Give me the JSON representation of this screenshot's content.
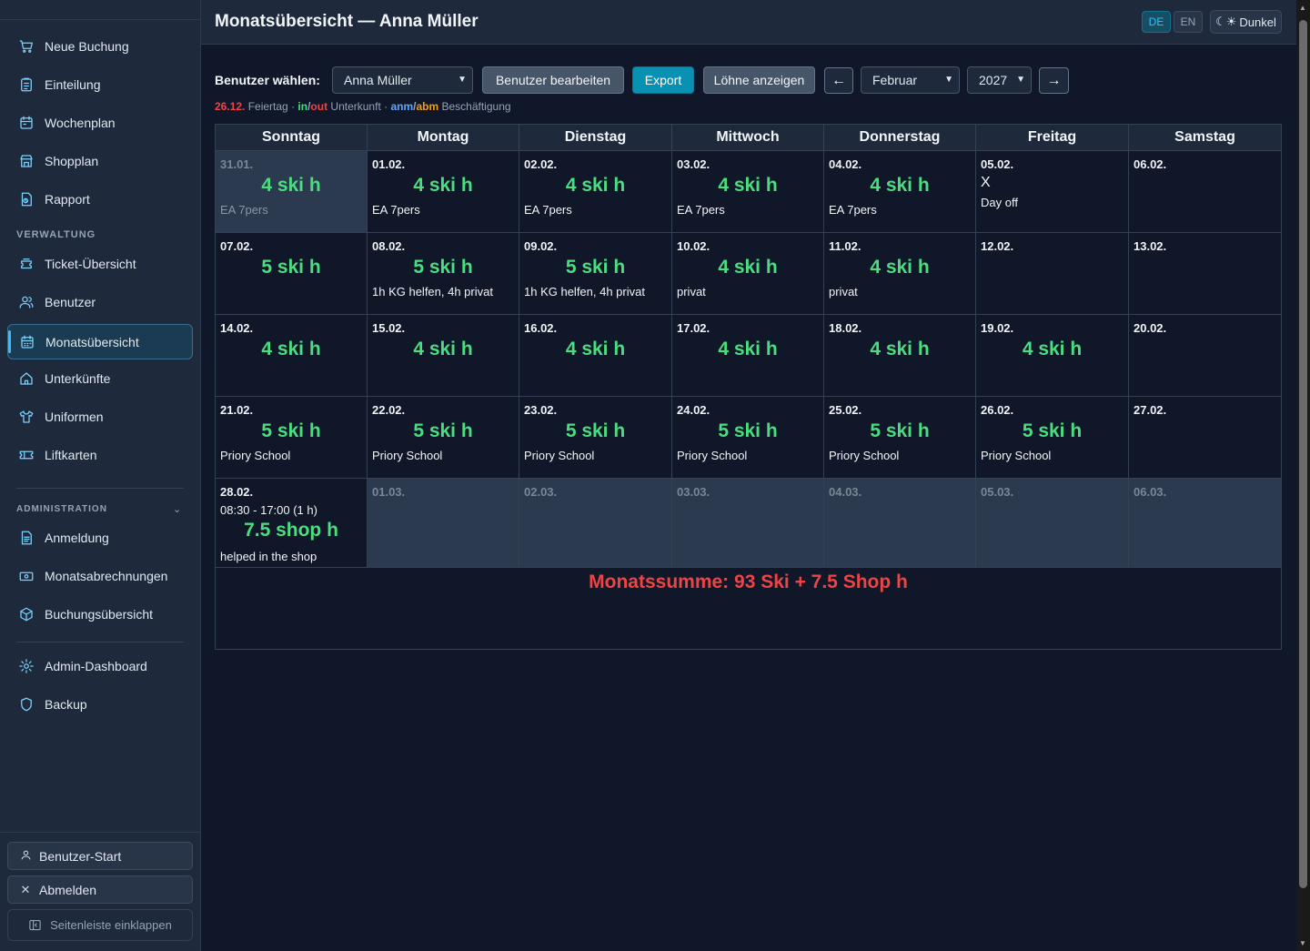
{
  "sidebar": {
    "items": [
      {
        "label": "Neue Buchung"
      },
      {
        "label": "Einteilung"
      },
      {
        "label": "Wochenplan"
      },
      {
        "label": "Shopplan"
      },
      {
        "label": "Rapport"
      },
      {
        "label": "Ticket-Übersicht"
      },
      {
        "label": "Benutzer"
      },
      {
        "label": "Monatsübersicht"
      },
      {
        "label": "Unterkünfte"
      },
      {
        "label": "Uniformen"
      },
      {
        "label": "Liftkarten"
      },
      {
        "label": "Anmeldung"
      },
      {
        "label": "Monatsabrechnungen"
      },
      {
        "label": "Buchungsübersicht"
      },
      {
        "label": "Admin-Dashboard"
      },
      {
        "label": "Backup"
      }
    ],
    "section_verwaltung": "VERWALTUNG",
    "section_administration": "ADMINISTRATION",
    "benutzer_start": "Benutzer-Start",
    "abmelden": "Abmelden",
    "collapse": "Seitenleiste einklappen"
  },
  "header": {
    "title": "Monatsübersicht — Anna Müller",
    "lang_de": "DE",
    "lang_en": "EN",
    "theme": "Dunkel"
  },
  "controls": {
    "user_label": "Benutzer wählen:",
    "user_value": "Anna Müller",
    "edit_user": "Benutzer bearbeiten",
    "export": "Export",
    "wages": "Löhne anzeigen",
    "prev": "←",
    "month": "Februar",
    "year": "2027",
    "next": "→"
  },
  "legend": {
    "holiday_date": "26.12.",
    "holiday_text": " Feiertag · ",
    "in": "in",
    "slash1": "/",
    "out": "out",
    "lodging": " Unterkunft · ",
    "anm": "anm",
    "slash2": "/",
    "abm": "abm",
    "employment": " Beschäftigung"
  },
  "calendar": {
    "weekdays": [
      "Sonntag",
      "Montag",
      "Dienstag",
      "Mittwoch",
      "Donnerstag",
      "Freitag",
      "Samstag"
    ],
    "weeks": [
      [
        {
          "date": "31.01.",
          "hours": "4 ski h",
          "note": "EA 7pers",
          "out": true
        },
        {
          "date": "01.02.",
          "hours": "4 ski h",
          "note": "EA 7pers"
        },
        {
          "date": "02.02.",
          "hours": "4 ski h",
          "note": "EA 7pers"
        },
        {
          "date": "03.02.",
          "hours": "4 ski h",
          "note": "EA 7pers"
        },
        {
          "date": "04.02.",
          "hours": "4 ski h",
          "note": "EA 7pers"
        },
        {
          "date": "05.02.",
          "mark": "X",
          "note": "Day off"
        },
        {
          "date": "06.02."
        }
      ],
      [
        {
          "date": "07.02.",
          "hours": "5 ski h"
        },
        {
          "date": "08.02.",
          "hours": "5 ski h",
          "note": "1h KG helfen, 4h privat"
        },
        {
          "date": "09.02.",
          "hours": "5 ski h",
          "note": "1h KG helfen, 4h privat"
        },
        {
          "date": "10.02.",
          "hours": "4 ski h",
          "note": "privat"
        },
        {
          "date": "11.02.",
          "hours": "4 ski h",
          "note": "privat"
        },
        {
          "date": "12.02."
        },
        {
          "date": "13.02."
        }
      ],
      [
        {
          "date": "14.02.",
          "hours": "4 ski h"
        },
        {
          "date": "15.02.",
          "hours": "4 ski h"
        },
        {
          "date": "16.02.",
          "hours": "4 ski h"
        },
        {
          "date": "17.02.",
          "hours": "4 ski h"
        },
        {
          "date": "18.02.",
          "hours": "4 ski h"
        },
        {
          "date": "19.02.",
          "hours": "4 ski h"
        },
        {
          "date": "20.02."
        }
      ],
      [
        {
          "date": "21.02.",
          "hours": "5 ski h",
          "note": "Priory School"
        },
        {
          "date": "22.02.",
          "hours": "5 ski h",
          "note": "Priory School"
        },
        {
          "date": "23.02.",
          "hours": "5 ski h",
          "note": "Priory School"
        },
        {
          "date": "24.02.",
          "hours": "5 ski h",
          "note": "Priory School"
        },
        {
          "date": "25.02.",
          "hours": "5 ski h",
          "note": "Priory School"
        },
        {
          "date": "26.02.",
          "hours": "5 ski h",
          "note": "Priory School"
        },
        {
          "date": "27.02."
        }
      ],
      [
        {
          "date": "28.02.",
          "time": "08:30 - 17:00 (1 h)",
          "hours": "7.5 shop h",
          "note": "helped in the shop"
        },
        {
          "date": "01.03.",
          "out": true
        },
        {
          "date": "02.03.",
          "out": true
        },
        {
          "date": "03.03.",
          "out": true
        },
        {
          "date": "04.03.",
          "out": true
        },
        {
          "date": "05.03.",
          "out": true
        },
        {
          "date": "06.03.",
          "out": true
        }
      ]
    ],
    "total": "Monatssumme: 93 Ski + 7.5 Shop h"
  }
}
